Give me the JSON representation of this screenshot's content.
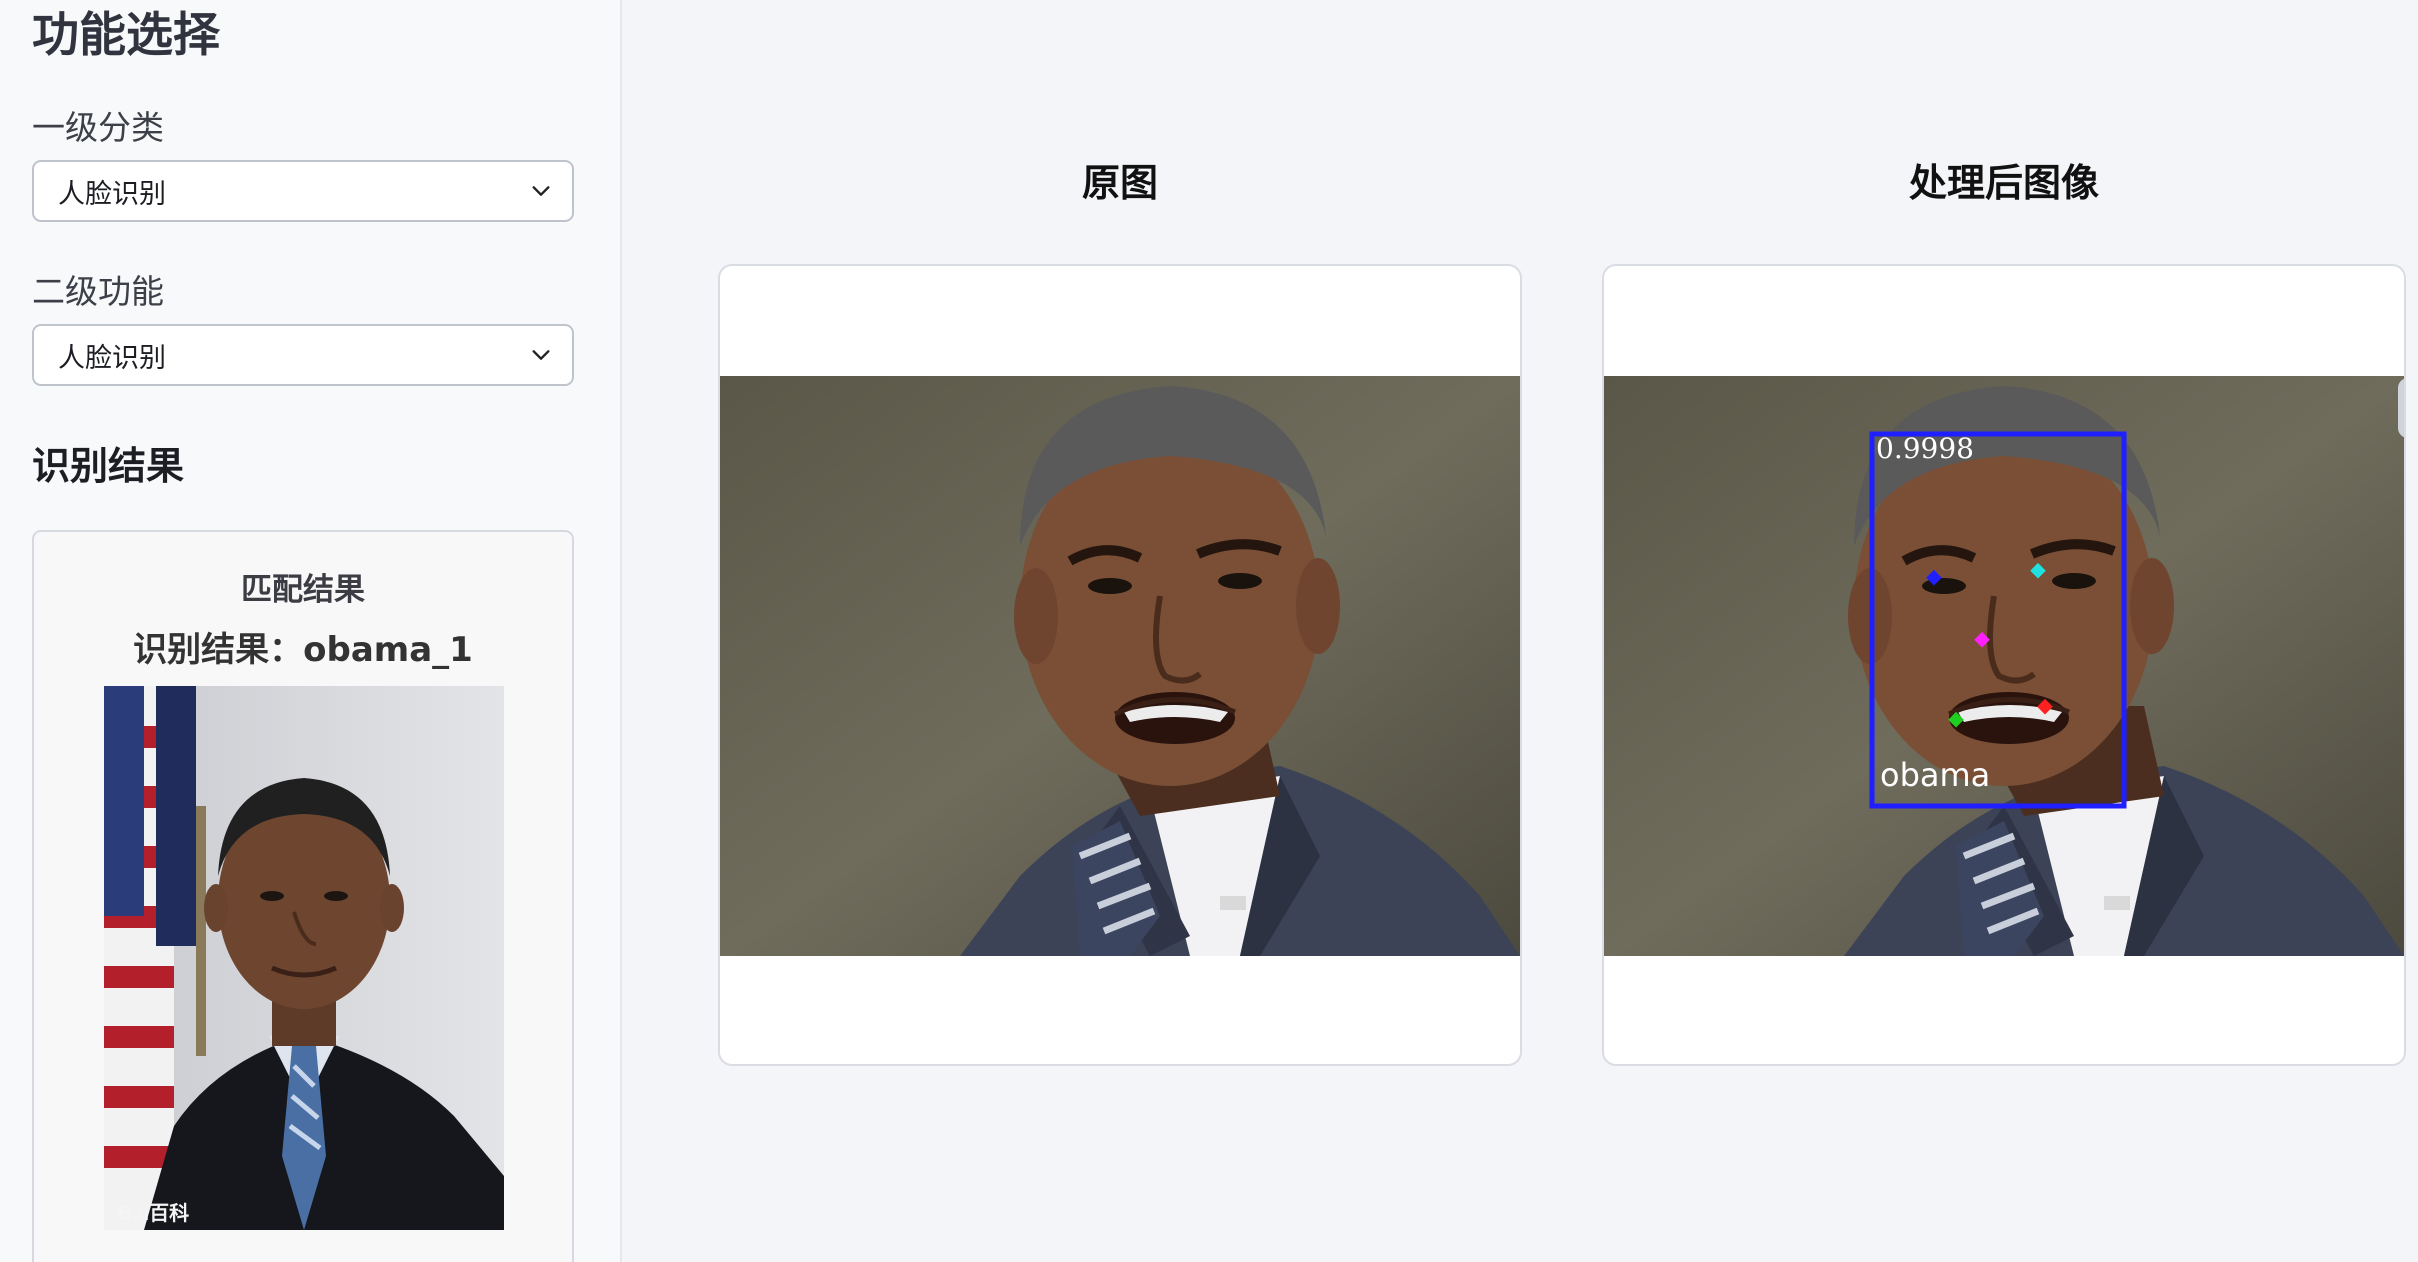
{
  "sidebar": {
    "title": "功能选择",
    "level1": {
      "label": "一级分类",
      "value": "人脸识别"
    },
    "level2": {
      "label": "二级功能",
      "value": "人脸识别"
    },
    "result_section": "识别结果",
    "match": {
      "title": "匹配结果",
      "result_text": "识别结果：obama_1",
      "watermark": "Bai百科"
    }
  },
  "main": {
    "original_title": "原图",
    "processed_title": "处理后图像",
    "detection": {
      "confidence": "0.9998",
      "name": "obama"
    }
  },
  "colors": {
    "bbox": "#1f1fff",
    "landmarks": [
      "#2020ff",
      "#20e0e0",
      "#ff20ff",
      "#20d020",
      "#ff2020"
    ]
  }
}
